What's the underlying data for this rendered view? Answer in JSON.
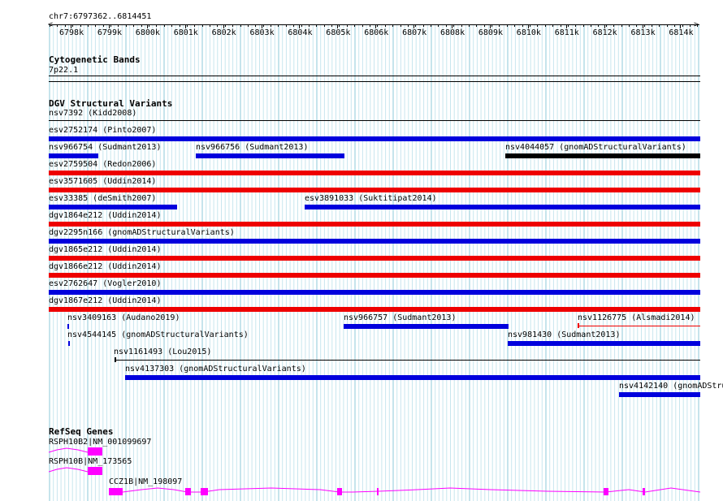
{
  "ruler": {
    "range_label": "chr7:6797362..6814451",
    "ticks": [
      "6798k",
      "6799k",
      "6800k",
      "6801k",
      "6802k",
      "6803k",
      "6804k",
      "6805k",
      "6806k",
      "6807k",
      "6808k",
      "6809k",
      "6810k",
      "6811k",
      "6812k",
      "6813k",
      "6814k"
    ]
  },
  "cytobands": {
    "title": "Cytogenetic Bands",
    "band": "7p22.1"
  },
  "dgv": {
    "title": "DGV Structural Variants",
    "features": [
      {
        "label": "nsv7392 (Kidd2008)",
        "color": "#000000",
        "style": "line"
      },
      {
        "label": "esv2752174 (Pinto2007)",
        "color": "#0000dd"
      },
      {
        "label": "nsv966754 (Sudmant2013)",
        "color": "#0000dd"
      },
      {
        "label": "nsv966756 (Sudmant2013)",
        "color": "#0000dd"
      },
      {
        "label": "nsv4044057 (gnomADStructuralVariants)",
        "color": "#000000"
      },
      {
        "label": "esv2759504 (Redon2006)",
        "color": "#ee0000"
      },
      {
        "label": "esv3571605 (Uddin2014)",
        "color": "#ee0000"
      },
      {
        "label": "esv33385 (deSmith2007)",
        "color": "#0000dd"
      },
      {
        "label": "esv3891033 (Suktitipat2014)",
        "color": "#0000dd"
      },
      {
        "label": "dgv1864e212 (Uddin2014)",
        "color": "#ee0000"
      },
      {
        "label": "dgv2295n166 (gnomADStructuralVariants)",
        "color": "#0000dd"
      },
      {
        "label": "dgv1865e212 (Uddin2014)",
        "color": "#ee0000"
      },
      {
        "label": "dgv1866e212 (Uddin2014)",
        "color": "#ee0000"
      },
      {
        "label": "esv2762647 (Vogler2010)",
        "color": "#0000dd"
      },
      {
        "label": "dgv1867e212 (Uddin2014)",
        "color": "#ee0000"
      },
      {
        "label": "nsv3409163 (Audano2019)",
        "color": "#0000dd"
      },
      {
        "label": "nsv966757 (Sudmant2013)",
        "color": "#0000dd"
      },
      {
        "label": "nsv1126775 (Alsmadi2014)",
        "color": "#ee0000",
        "style": "line"
      },
      {
        "label": "nsv4544145 (gnomADStructuralVariants)",
        "color": "#0000dd"
      },
      {
        "label": "nsv981430 (Sudmant2013)",
        "color": "#0000dd"
      },
      {
        "label": "nsv1161493 (Lou2015)",
        "color": "#000000",
        "style": "line"
      },
      {
        "label": "nsv4137303 (gnomADStructuralVariants)",
        "color": "#0000dd"
      },
      {
        "label": "nsv4142140 (gnomADStru",
        "color": "#0000dd"
      }
    ]
  },
  "refseq": {
    "title": "RefSeq Genes",
    "color": "#ff00ff",
    "genes": [
      {
        "label": "RSPH10B2|NM_001099697"
      },
      {
        "label": "RSPH10B|NM_173565"
      },
      {
        "label": "CCZ1B|NM_198097"
      }
    ]
  }
}
